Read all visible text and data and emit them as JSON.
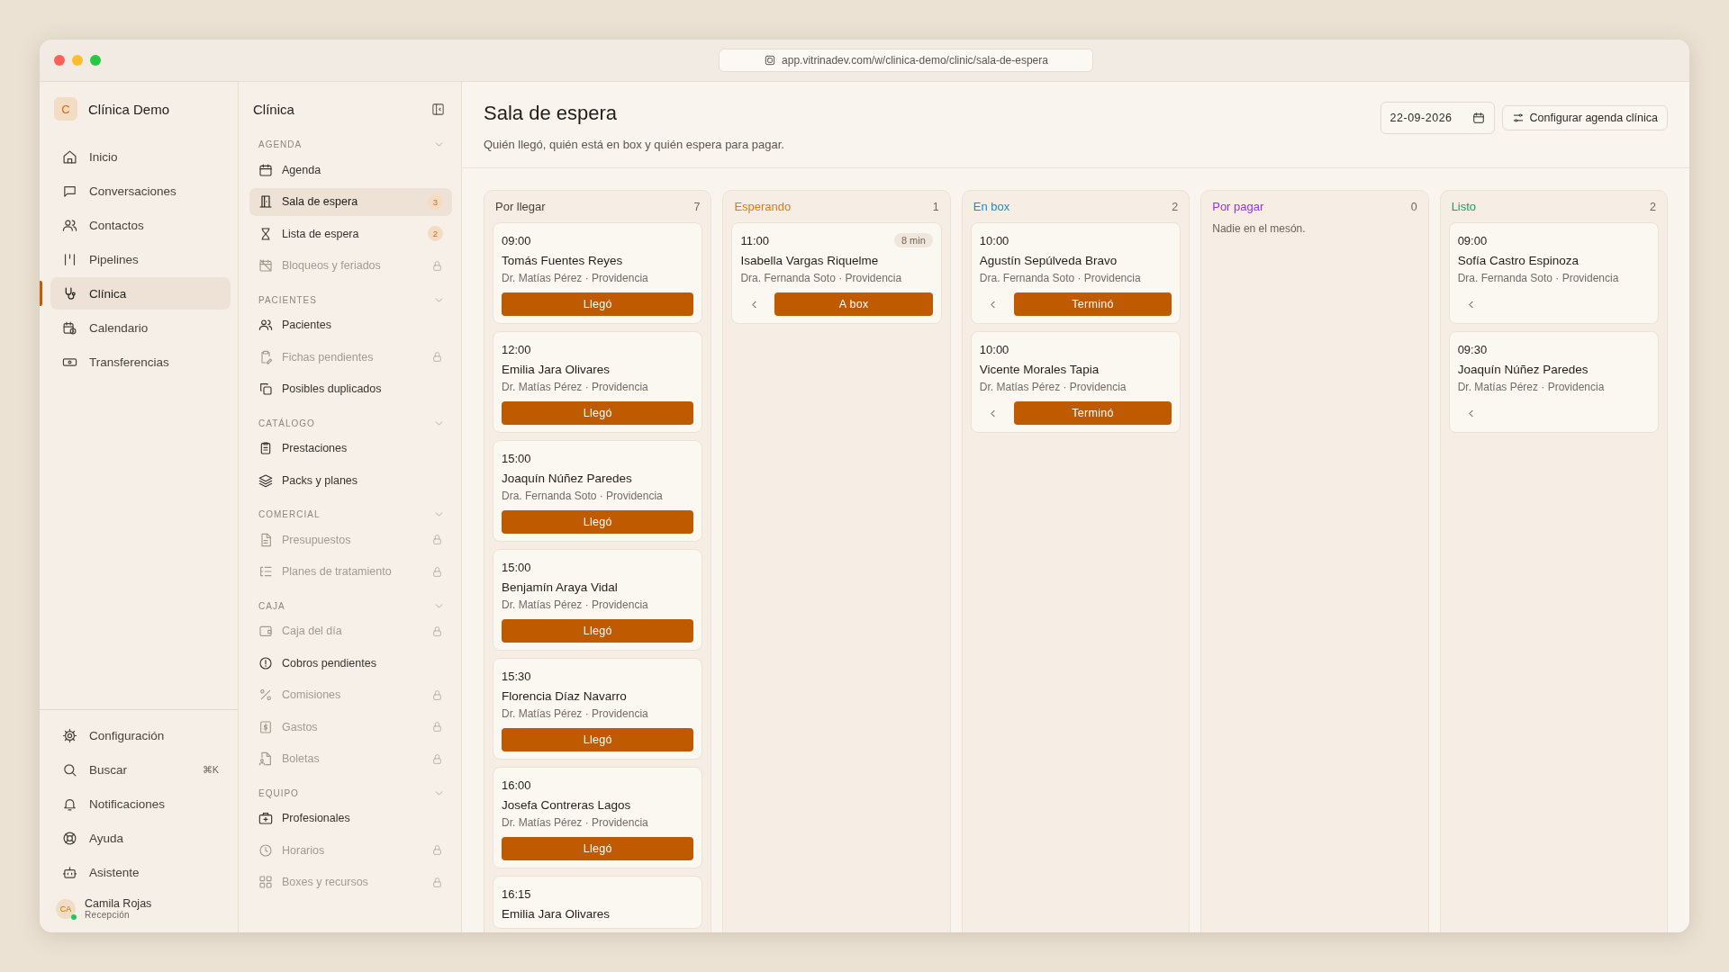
{
  "browser": {
    "url": "app.vitrinadev.com/w/clinica-demo/clinic/sala-de-espera"
  },
  "workspace": {
    "initial": "C",
    "name": "Clínica Demo"
  },
  "main_nav": [
    {
      "label": "Inicio",
      "selected": false
    },
    {
      "label": "Conversaciones",
      "selected": false
    },
    {
      "label": "Contactos",
      "selected": false
    },
    {
      "label": "Pipelines",
      "selected": false
    },
    {
      "label": "Clínica",
      "selected": true
    },
    {
      "label": "Calendario",
      "selected": false
    },
    {
      "label": "Transferencias",
      "selected": false
    }
  ],
  "bottom_nav": [
    {
      "label": "Configuración"
    },
    {
      "label": "Buscar",
      "shortcut": "⌘K"
    },
    {
      "label": "Notificaciones"
    },
    {
      "label": "Ayuda"
    },
    {
      "label": "Asistente"
    }
  ],
  "user": {
    "initials": "CA",
    "name": "Camila Rojas",
    "role": "Recepción",
    "online": true
  },
  "section_nav": {
    "title": "Clínica",
    "groups": [
      {
        "title": "AGENDA",
        "items": [
          {
            "label": "Agenda",
            "selected": false,
            "locked": false
          },
          {
            "label": "Sala de espera",
            "selected": true,
            "locked": false,
            "badge": "3"
          },
          {
            "label": "Lista de espera",
            "selected": false,
            "locked": false,
            "badge": "2"
          },
          {
            "label": "Bloqueos y feriados",
            "selected": false,
            "locked": true
          }
        ]
      },
      {
        "title": "PACIENTES",
        "items": [
          {
            "label": "Pacientes",
            "selected": false,
            "locked": false
          },
          {
            "label": "Fichas pendientes",
            "selected": false,
            "locked": true
          },
          {
            "label": "Posibles duplicados",
            "selected": false,
            "locked": false
          }
        ]
      },
      {
        "title": "CATÁLOGO",
        "items": [
          {
            "label": "Prestaciones",
            "selected": false,
            "locked": false
          },
          {
            "label": "Packs y planes",
            "selected": false,
            "locked": false
          }
        ]
      },
      {
        "title": "COMERCIAL",
        "items": [
          {
            "label": "Presupuestos",
            "selected": false,
            "locked": true
          },
          {
            "label": "Planes de tratamiento",
            "selected": false,
            "locked": true
          }
        ]
      },
      {
        "title": "CAJA",
        "items": [
          {
            "label": "Caja del día",
            "selected": false,
            "locked": true
          },
          {
            "label": "Cobros pendientes",
            "selected": false,
            "locked": false
          },
          {
            "label": "Comisiones",
            "selected": false,
            "locked": true
          },
          {
            "label": "Gastos",
            "selected": false,
            "locked": true
          },
          {
            "label": "Boletas",
            "selected": false,
            "locked": true
          }
        ]
      },
      {
        "title": "EQUIPO",
        "items": [
          {
            "label": "Profesionales",
            "selected": false,
            "locked": false
          },
          {
            "label": "Horarios",
            "selected": false,
            "locked": true
          },
          {
            "label": "Boxes y recursos",
            "selected": false,
            "locked": true
          }
        ]
      }
    ]
  },
  "page": {
    "title": "Sala de espera",
    "subtitle": "Quién llegó, quién está en box y quién espera para pagar.",
    "date": "22-09-2026",
    "config_button": "Configurar agenda clínica"
  },
  "board": {
    "columns": [
      {
        "title": "Por llegar",
        "color": "#4a423b",
        "count": "7",
        "cards": [
          {
            "time": "09:00",
            "name": "Tomás Fuentes Reyes",
            "detail": "Dr. Matías Pérez · Providencia",
            "back": false,
            "action": "Llegó"
          },
          {
            "time": "12:00",
            "name": "Emilia Jara Olivares",
            "detail": "Dr. Matías Pérez · Providencia",
            "back": false,
            "action": "Llegó"
          },
          {
            "time": "15:00",
            "name": "Joaquín Núñez Paredes",
            "detail": "Dra. Fernanda Soto · Providencia",
            "back": false,
            "action": "Llegó"
          },
          {
            "time": "15:00",
            "name": "Benjamín Araya Vidal",
            "detail": "Dr. Matías Pérez · Providencia",
            "back": false,
            "action": "Llegó"
          },
          {
            "time": "15:30",
            "name": "Florencia Díaz Navarro",
            "detail": "Dr. Matías Pérez · Providencia",
            "back": false,
            "action": "Llegó"
          },
          {
            "time": "16:00",
            "name": "Josefa Contreras Lagos",
            "detail": "Dr. Matías Pérez · Providencia",
            "back": false,
            "action": "Llegó"
          },
          {
            "time": "16:15",
            "name": "Emilia Jara Olivares",
            "back": false
          }
        ]
      },
      {
        "title": "Esperando",
        "color": "#e07a10",
        "count": "1",
        "cards": [
          {
            "time": "11:00",
            "name": "Isabella Vargas Riquelme",
            "detail": "Dra. Fernanda Soto · Providencia",
            "wait": "8 min",
            "back": true,
            "action": "A box"
          }
        ]
      },
      {
        "title": "En box",
        "color": "#1b8bd0",
        "count": "2",
        "cards": [
          {
            "time": "10:00",
            "name": "Agustín Sepúlveda Bravo",
            "detail": "Dra. Fernanda Soto · Providencia",
            "back": true,
            "action": "Terminó"
          },
          {
            "time": "10:00",
            "name": "Vicente Morales Tapia",
            "detail": "Dr. Matías Pérez · Providencia",
            "back": true,
            "action": "Terminó"
          }
        ]
      },
      {
        "title": "Por pagar",
        "color": "#9334ea",
        "count": "0",
        "empty_text": "Nadie en el mesón."
      },
      {
        "title": "Listo",
        "color": "#17a067",
        "count": "2",
        "cards": [
          {
            "time": "09:00",
            "name": "Sofía Castro Espinoza",
            "detail": "Dra. Fernanda Soto · Providencia",
            "back": true
          },
          {
            "time": "09:30",
            "name": "Joaquín Núñez Paredes",
            "detail": "Dr. Matías Pérez · Providencia",
            "back": true
          }
        ]
      }
    ]
  }
}
